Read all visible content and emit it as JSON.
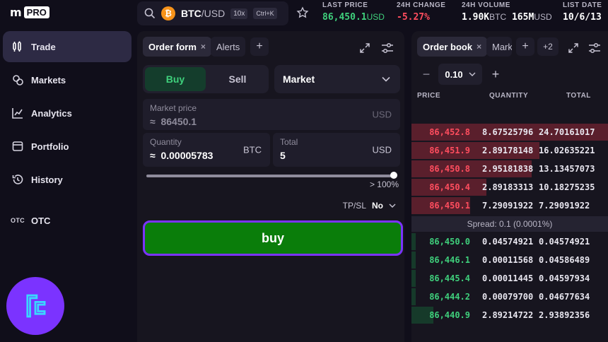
{
  "brand": {
    "name": "kraken",
    "badge": "PRO"
  },
  "nav": [
    {
      "label": "Trade",
      "icon": "trade-icon",
      "active": true
    },
    {
      "label": "Markets",
      "icon": "markets-icon",
      "active": false
    },
    {
      "label": "Analytics",
      "icon": "analytics-icon",
      "active": false
    },
    {
      "label": "Portfolio",
      "icon": "portfolio-icon",
      "active": false
    },
    {
      "label": "History",
      "icon": "history-icon",
      "active": false
    },
    {
      "label": "OTC",
      "icon_text": "OTC",
      "active": false
    }
  ],
  "header": {
    "pair_base": "BTC",
    "pair_quote": "/USD",
    "leverage": "10x",
    "shortcut": "Ctrl+K",
    "last_price": {
      "label": "LAST PRICE",
      "value": "86,450.1",
      "unit": "USD"
    },
    "change": {
      "label": "24H CHANGE",
      "value": "-5.27%"
    },
    "volume": {
      "label": "24H VOLUME",
      "btc": "1.90K",
      "btc_unit": "BTC",
      "usd": "165M",
      "usd_unit": "USD"
    },
    "list_date": {
      "label": "LIST DATE",
      "value": "10/6/13"
    }
  },
  "order_panel": {
    "tabs": [
      {
        "label": "Order form",
        "close": "×"
      },
      {
        "label": "Alerts"
      }
    ],
    "side_buy": "Buy",
    "side_sell": "Sell",
    "order_type": "Market",
    "market_price": {
      "label": "Market price",
      "approx": "≈",
      "value": "86450.1",
      "unit": "USD"
    },
    "quantity": {
      "label": "Quantity",
      "approx": "≈",
      "value": "0.00005783",
      "unit": "BTC"
    },
    "total": {
      "label": "Total",
      "value": "5",
      "unit": "USD"
    },
    "slider_percent": "> 100%",
    "slider_fraction": 1.0,
    "tpsl_label": "TP/SL",
    "tpsl_value": "No",
    "submit_label": "buy"
  },
  "order_book": {
    "tabs": [
      {
        "label": "Order book",
        "close": "×"
      },
      {
        "label": "Mark"
      }
    ],
    "extra_tabs": "+2",
    "precision": "0.10",
    "columns": [
      "PRICE",
      "QUANTITY",
      "TOTAL"
    ],
    "asks": [
      {
        "price": "86,452.8",
        "qty": "8.67525796",
        "total": "24.70161017",
        "depth": 1.0
      },
      {
        "price": "86,451.9",
        "qty": "2.89178148",
        "total": "16.02635221",
        "depth": 0.65
      },
      {
        "price": "86,450.8",
        "qty": "2.95181838",
        "total": "13.13457073",
        "depth": 0.61
      },
      {
        "price": "86,450.4",
        "qty": "2.89183313",
        "total": "10.18275235",
        "depth": 0.38
      },
      {
        "price": "86,450.1",
        "qty": "7.29091922",
        "total": "7.29091922",
        "depth": 0.3
      }
    ],
    "spread": "Spread: 0.1 (0.0001%)",
    "bids": [
      {
        "price": "86,450.0",
        "qty": "0.04574921",
        "total": "0.04574921",
        "depth": 0.02
      },
      {
        "price": "86,446.1",
        "qty": "0.00011568",
        "total": "0.04586489",
        "depth": 0.02
      },
      {
        "price": "86,445.4",
        "qty": "0.00011445",
        "total": "0.04597934",
        "depth": 0.02
      },
      {
        "price": "86,444.2",
        "qty": "0.00079700",
        "total": "0.04677634",
        "depth": 0.02
      },
      {
        "price": "86,440.9",
        "qty": "2.89214722",
        "total": "2.93892356",
        "depth": 0.11
      }
    ]
  },
  "colors": {
    "bg": "#100e1a",
    "panel": "#17151f",
    "accent": "#7b33ff",
    "green": "#3fd07c",
    "red": "#ff4d5e",
    "buy_button": "#0a7d0a",
    "ask_depth": "#5a1f2c",
    "bid_depth": "#163a2a"
  }
}
